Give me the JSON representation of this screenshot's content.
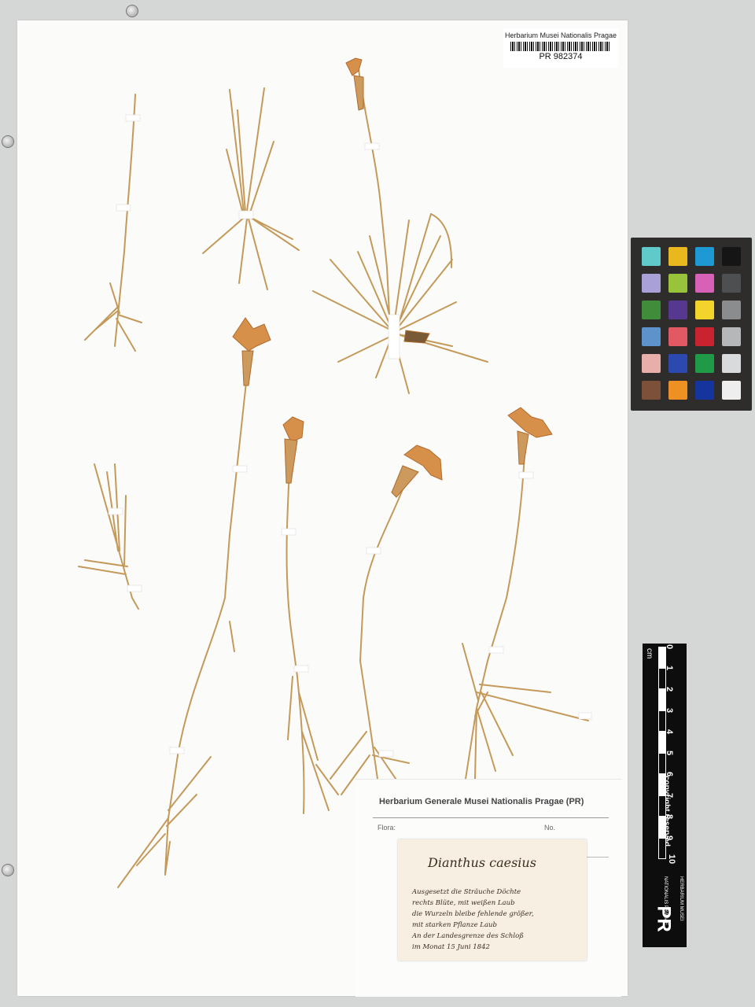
{
  "barcode": {
    "institution": "Herbarium Musei Nationalis Pragae",
    "number": "PR 982374"
  },
  "color_card": {
    "patches": [
      "#5fcac9",
      "#e9b81f",
      "#1d9ad4",
      "#151515",
      "#a8a0d7",
      "#97c43a",
      "#d761b7",
      "#4e4f51",
      "#3f8d3b",
      "#563890",
      "#f3d42b",
      "#8b8c8e",
      "#5c93cb",
      "#e25863",
      "#c9232f",
      "#b6b7b8",
      "#e7aeaa",
      "#2c49b0",
      "#1f9a47",
      "#d9dadb",
      "#7d5039",
      "#ee9022",
      "#15349d",
      "#eeeeee"
    ]
  },
  "ruler": {
    "unit": "cm",
    "numbers": [
      "0",
      "1",
      "2",
      "3",
      "4",
      "5",
      "6",
      "7",
      "8",
      "9",
      "10"
    ],
    "copyright": "copyright reserved",
    "logo_text": "PR",
    "logo_top": "HERBARIUM MUSEI",
    "logo_bottom": "NATIONALIS PRAGAE"
  },
  "label": {
    "header": "Herbarium Generale Musei Nationalis Pragae (PR)",
    "flora_label": "Flora:",
    "no_label": "No.",
    "taxon": "Dianthus caesius",
    "notes": [
      "Ausgesetzt die Sträuche Döchte",
      "rechts Blüte, mit weißen Laub",
      "die Wurzeln bleibe fehlende größer,",
      "mit starken Pflanze Laub",
      "An der Landesgrenze des Schloß",
      "im Monat 15 Juni 1842"
    ]
  }
}
